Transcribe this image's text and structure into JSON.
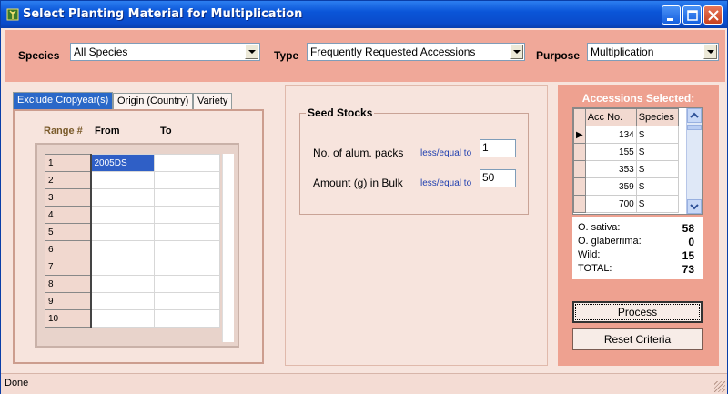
{
  "window": {
    "title": "Select Planting Material for Multiplication"
  },
  "filters": {
    "species_label": "Species",
    "species_value": "All Species",
    "type_label": "Type",
    "type_value": "Frequently Requested Accessions",
    "purpose_label": "Purpose",
    "purpose_value": "Multiplication"
  },
  "tabs": [
    {
      "label": "Exclude Cropyear(s)"
    },
    {
      "label": "Origin (Country)"
    },
    {
      "label": "Variety"
    }
  ],
  "range_grid": {
    "headers": {
      "range": "Range #",
      "from": "From",
      "to": "To"
    },
    "rows": [
      {
        "n": "1",
        "from": "2005DS",
        "to": ""
      },
      {
        "n": "2",
        "from": "",
        "to": ""
      },
      {
        "n": "3",
        "from": "",
        "to": ""
      },
      {
        "n": "4",
        "from": "",
        "to": ""
      },
      {
        "n": "5",
        "from": "",
        "to": ""
      },
      {
        "n": "6",
        "from": "",
        "to": ""
      },
      {
        "n": "7",
        "from": "",
        "to": ""
      },
      {
        "n": "8",
        "from": "",
        "to": ""
      },
      {
        "n": "9",
        "from": "",
        "to": ""
      },
      {
        "n": "10",
        "from": "",
        "to": ""
      }
    ]
  },
  "seed_stocks": {
    "title": "Seed Stocks",
    "packs_label": "No. of alum. packs",
    "packs_condition": "less/equal to",
    "packs_value": "1",
    "bulk_label": "Amount (g) in Bulk",
    "bulk_condition": "less/equal to",
    "bulk_value": "50"
  },
  "accessions": {
    "title": "Accessions Selected:",
    "col_acc": "Acc No.",
    "col_species": "Species",
    "rows": [
      {
        "acc": "134",
        "species": "S"
      },
      {
        "acc": "155",
        "species": "S"
      },
      {
        "acc": "353",
        "species": "S"
      },
      {
        "acc": "359",
        "species": "S"
      },
      {
        "acc": "700",
        "species": "S"
      }
    ],
    "stats": [
      {
        "label": "O. sativa:",
        "value": "58"
      },
      {
        "label": "O. glaberrima:",
        "value": "0"
      },
      {
        "label": "Wild:",
        "value": "15"
      },
      {
        "label": "TOTAL:",
        "value": "73"
      }
    ]
  },
  "buttons": {
    "process": "Process",
    "reset": "Reset Criteria"
  },
  "status": {
    "text": "Done"
  }
}
